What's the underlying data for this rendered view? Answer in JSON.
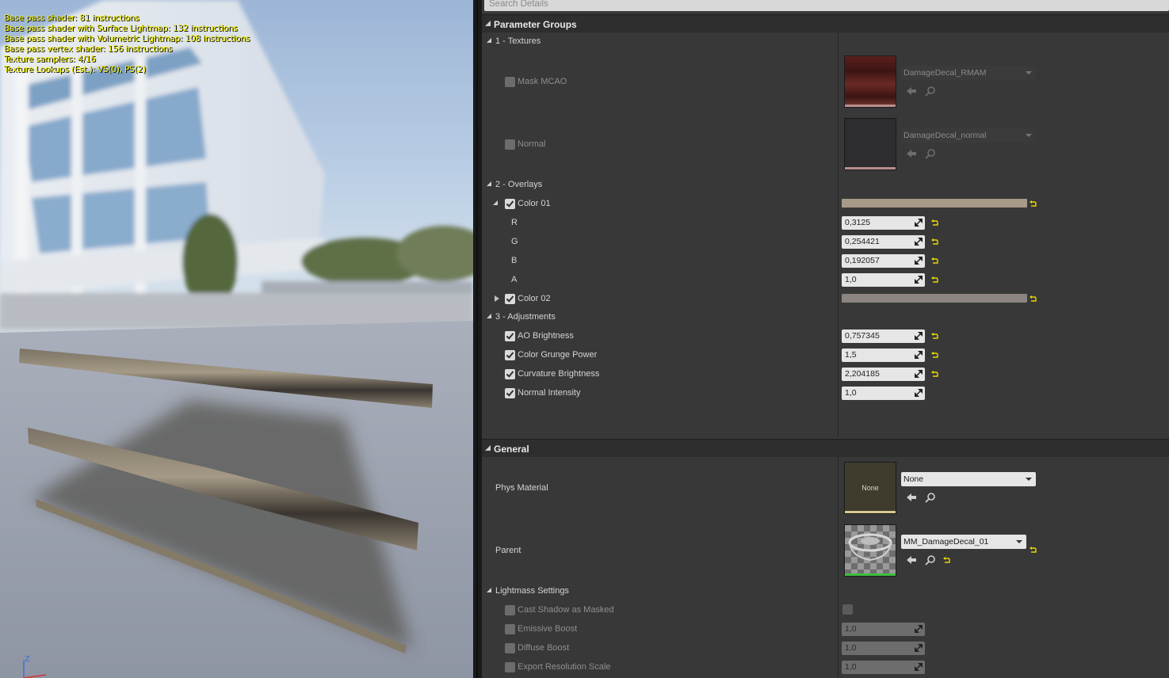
{
  "viewport": {
    "stats": [
      "Base pass shader: 81 instructions",
      "Base pass shader with Surface Lightmap: 132 instructions",
      "Base pass shader with Volumetric Lightmap: 108 instructions",
      "Base pass vertex shader: 156 instructions",
      "Texture samplers: 4/16",
      "Texture Lookups (Est.): VS(0), PS(2)"
    ],
    "axis_label": "Z"
  },
  "details": {
    "search_placeholder": "Search Details",
    "parameter_groups": {
      "title": "Parameter Groups",
      "textures": {
        "title": "1 - Textures",
        "mask": {
          "label": "Mask MCAO",
          "asset": "DamageDecal_RMAM"
        },
        "normal": {
          "label": "Normal",
          "asset": "DamageDecal_normal"
        }
      },
      "overlays": {
        "title": "2 - Overlays",
        "color01": {
          "label": "Color 01",
          "swatch": "#a89a88",
          "r_label": "R",
          "r": "0,3125",
          "g_label": "G",
          "g": "0,254421",
          "b_label": "B",
          "b": "0,192057",
          "a_label": "A",
          "a": "1,0"
        },
        "color02": {
          "label": "Color 02",
          "swatch": "#8c8480"
        }
      },
      "adjustments": {
        "title": "3 - Adjustments",
        "ao_brightness": {
          "label": "AO Brightness",
          "value": "0,757345"
        },
        "grunge_power": {
          "label": "Color Grunge Power",
          "value": "1,5"
        },
        "curvature": {
          "label": "Curvature Brightness",
          "value": "2,204185"
        },
        "normal_intensity": {
          "label": "Normal Intensity",
          "value": "1,0"
        }
      }
    },
    "general": {
      "title": "General",
      "phys_material": {
        "label": "Phys Material",
        "thumb_text": "None",
        "value": "None"
      },
      "parent": {
        "label": "Parent",
        "value": "MM_DamageDecal_01"
      },
      "lightmass": {
        "title": "Lightmass Settings",
        "cast_shadow": {
          "label": "Cast Shadow as Masked"
        },
        "emissive_boost": {
          "label": "Emissive Boost",
          "value": "1,0"
        },
        "diffuse_boost": {
          "label": "Diffuse Boost",
          "value": "1,0"
        },
        "export_res": {
          "label": "Export Resolution Scale",
          "value": "1,0"
        }
      }
    }
  },
  "colors": {
    "accent_reset": "#e8d700",
    "stats_text": "#f3f000"
  }
}
